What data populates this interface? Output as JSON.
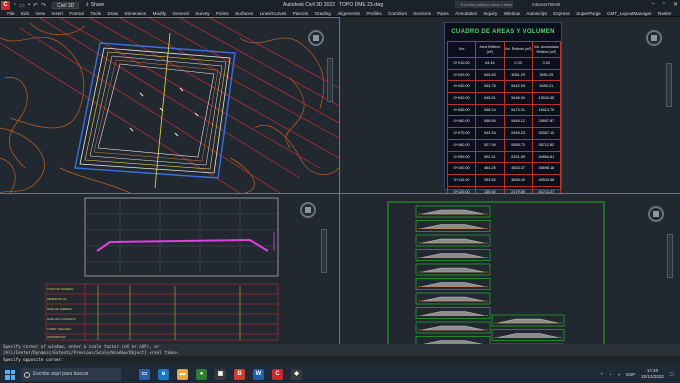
{
  "app": {
    "title": "Autodesk Civil 3D 2022",
    "document": "TOPO DME 23.dwg",
    "workspace": "Civil 3D",
    "share": "Share",
    "search_placeholder": "Escriba palabra clave o frase",
    "user": "mturner7WAB"
  },
  "menu": [
    "File",
    "Edit",
    "View",
    "Insert",
    "Format",
    "Tools",
    "Draw",
    "Dimension",
    "Modify",
    "Parametric",
    "Window",
    "Help",
    "General",
    "Survey",
    "Points",
    "Surfaces",
    "Lines/Curves",
    "Parcels",
    "Grading",
    "Alignments",
    "Profiles",
    "Corridors",
    "Sections",
    "Pipes",
    "Annotation",
    "Inquiry",
    "Window",
    "Autoscript",
    "Express",
    "SuperPurge",
    "CMT_LayoutManager",
    "Raster"
  ],
  "menu_visible": [
    "File",
    "Edit",
    "View",
    "Insert",
    "Format",
    "Tools",
    "Draw",
    "Dimension",
    "Modify",
    "General",
    "Survey",
    "Points",
    "Surfaces",
    "Lines/Curves",
    "Parcels",
    "Grading",
    "Alignments",
    "Profiles",
    "Corridors",
    "Sections",
    "Pipes",
    "Annotation",
    "Inquiry",
    "Window",
    "Autoscript",
    "Express",
    "SuperPurge",
    "CMT_LayoutManager",
    "Raster"
  ],
  "table": {
    "title": "CUADRO DE AREAS Y VOLUMEN",
    "headers": [
      "Km",
      "Area Relleno (m²)",
      "Vol. Relleno (m³)",
      "Vol. Acumulado Relleno (m³)"
    ],
    "rows": [
      [
        "0+010.00",
        "64.44",
        "0.00",
        "0.00"
      ],
      [
        "0+020.00",
        "545.83",
        "3051.29",
        "3051.29"
      ],
      [
        "0+030.00",
        "543.76",
        "5442.93",
        "8494.21"
      ],
      [
        "0+040.00",
        "546.51",
        "5446.34",
        "13940.55"
      ],
      [
        "0+050.00",
        "548.14",
        "5473.31",
        "19413.75"
      ],
      [
        "0+060.00",
        "548.69",
        "5484.12",
        "24897.87"
      ],
      [
        "0+070.00",
        "543.16",
        "5459.23",
        "30357.10"
      ],
      [
        "0+080.00",
        "527.99",
        "5355.72",
        "35712.82"
      ],
      [
        "0+090.00",
        "502.41",
        "5151.99",
        "40864.81"
      ],
      [
        "0+100.00",
        "464.26",
        "4833.37",
        "45698.18"
      ],
      [
        "0+110.00",
        "393.62",
        "3836.40",
        "49534.58"
      ],
      [
        "0+120.00",
        "135.92",
        "2179.69",
        "51714.27"
      ],
      [
        "0+125.00",
        "51.59",
        "461.28",
        "52175.56"
      ]
    ]
  },
  "command": {
    "line1": "Specify corner of window, enter a scale factor (nX or nXP), or",
    "line2": "[All/Center/Dynamic/Extents/Previous/Scale/Window/Object] <real time>:",
    "line3": "Specify opposite corner:"
  },
  "taskbar": {
    "search": "Escribe aquí para buscar",
    "lang": "ESP",
    "time": "17:40",
    "date": "22/12/2022"
  },
  "profile_labels": [
    "COTAS DE TERRENO",
    "PENDIENTE (%)",
    "NIVEL DE TERRENO",
    "NIVEL DE LA RASANTE",
    "CORTE Y RELLENO",
    "PROGRESIVAS"
  ]
}
